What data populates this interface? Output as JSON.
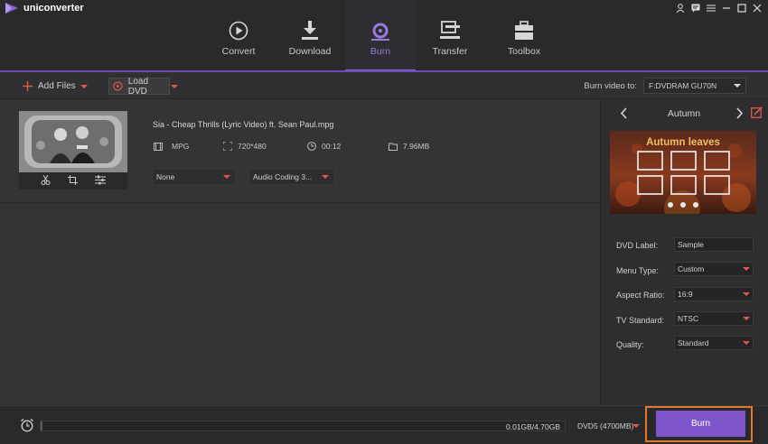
{
  "app": {
    "name": "uniconverter"
  },
  "nav": {
    "tabs": [
      {
        "label": "Convert",
        "icon": "convert-icon",
        "active": false
      },
      {
        "label": "Download",
        "icon": "download-icon",
        "active": false
      },
      {
        "label": "Burn",
        "icon": "burn-icon",
        "active": true
      },
      {
        "label": "Transfer",
        "icon": "transfer-icon",
        "active": false
      },
      {
        "label": "Toolbox",
        "icon": "toolbox-icon",
        "active": false
      }
    ]
  },
  "toolbar": {
    "add_files_label": "Add Files",
    "load_dvd_label": "Load DVD",
    "burn_to_label": "Burn video to:",
    "burn_to_value": "F:DVDRAM GU70N"
  },
  "file": {
    "name": "Sia - Cheap Thrills (Lyric Video) ft. Sean Paul.mpg",
    "format": "MPG",
    "resolution": "720*480",
    "duration": "00:12",
    "size": "7.96MB",
    "subtitle_value": "None",
    "audio_value": "Audio Coding 3..."
  },
  "theme": {
    "name": "Autumn",
    "preview_title": "Autumn leaves"
  },
  "settings": {
    "dvd_label": {
      "label": "DVD Label:",
      "value": "Sample"
    },
    "menu_type": {
      "label": "Menu Type:",
      "value": "Custom"
    },
    "aspect_ratio": {
      "label": "Aspect Ratio:",
      "value": "16:9"
    },
    "tv_standard": {
      "label": "TV Standard:",
      "value": "NTSC"
    },
    "quality": {
      "label": "Quality:",
      "value": "Standard"
    }
  },
  "bottom": {
    "progress_text": "0.01GB/4.70GB",
    "progress_fraction": 0.002,
    "disc_type": "DVD5 (4700MB)",
    "burn_label": "Burn"
  },
  "colors": {
    "accent": "#7e54cc",
    "highlight": "#e07a2a",
    "caret": "#e05a4a"
  }
}
